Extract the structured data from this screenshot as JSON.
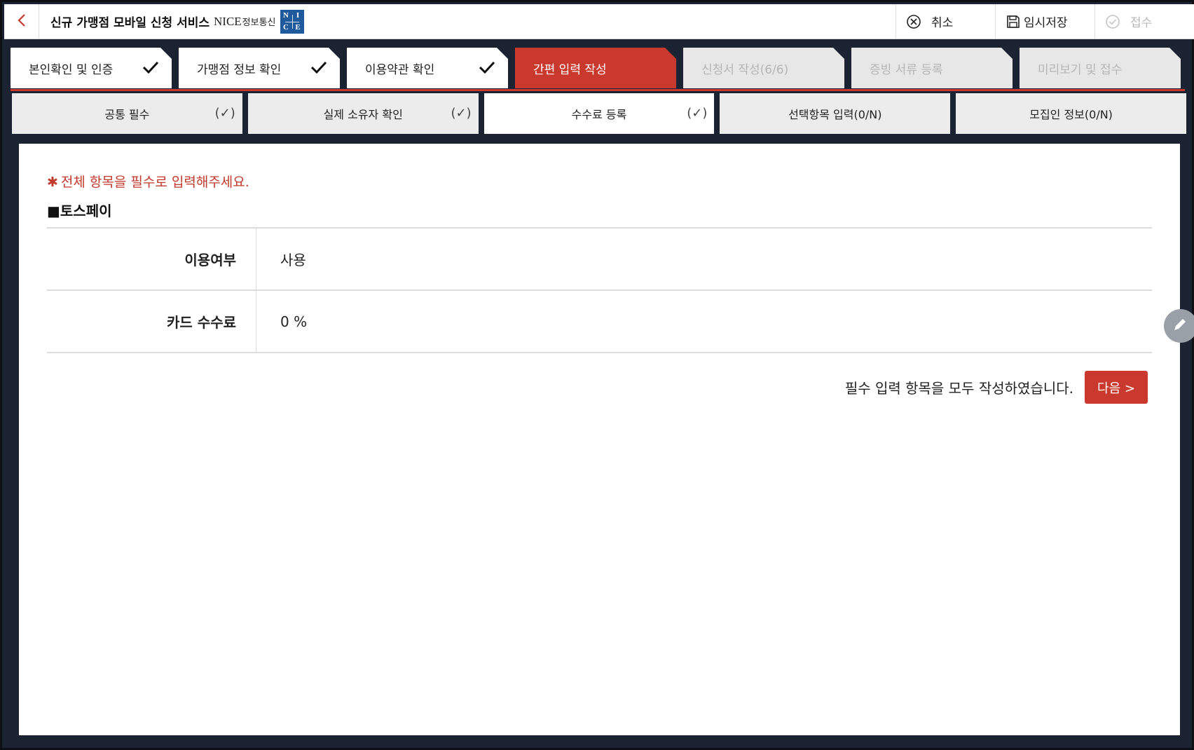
{
  "header": {
    "title": "신규 가맹점 모바일 신청 서비스",
    "brand": "NICE",
    "brand_sub": "정보통신",
    "logo_letters": [
      "N",
      "I",
      "C",
      "E"
    ],
    "actions": {
      "cancel": "취소",
      "save": "임시저장",
      "submit": "접수"
    }
  },
  "steps": [
    {
      "label": "본인확인 및 인증",
      "state": "done"
    },
    {
      "label": "가맹점 정보 확인",
      "state": "done"
    },
    {
      "label": "이용약관 확인",
      "state": "done"
    },
    {
      "label": "간편 입력 작성",
      "state": "active"
    },
    {
      "label": "신청서 작성(6/6)",
      "state": "disabled"
    },
    {
      "label": "증빙 서류 등록",
      "state": "disabled"
    },
    {
      "label": "미리보기 및 접수",
      "state": "disabled"
    }
  ],
  "subtabs": [
    {
      "label": "공통 필수",
      "mark": "(✓)"
    },
    {
      "label": "실제 소유자 확인",
      "mark": "(✓)"
    },
    {
      "label": "수수료 등록",
      "mark": "(✓)"
    },
    {
      "label": "선택항목 입력(0/N)",
      "mark": ""
    },
    {
      "label": "모집인 정보(0/N)",
      "mark": ""
    }
  ],
  "content": {
    "notice_star": "✱",
    "notice": "전체 항목을 필수로 입력해주세요.",
    "section_title": "■토스페이",
    "rows": [
      {
        "label": "이용여부",
        "value": "사용"
      },
      {
        "label": "카드 수수료",
        "value": "0 %"
      }
    ],
    "footer_message": "필수 입력 항목을 모두 작성하였습니다.",
    "next_label": "다음 >"
  },
  "colors": {
    "accent": "#c9392d",
    "frame": "#1b2231",
    "disabled_tab": "#e7e7e7"
  }
}
